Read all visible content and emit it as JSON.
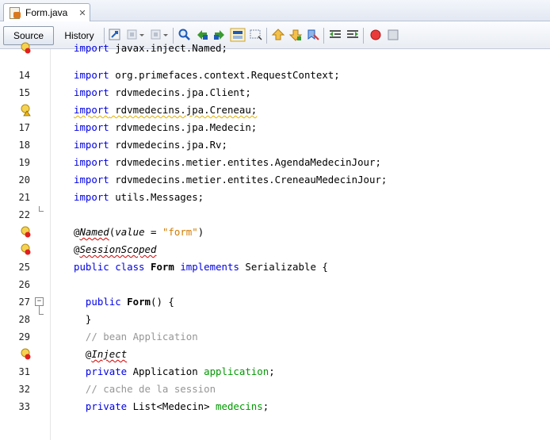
{
  "tab": {
    "filename": "Form.java",
    "close_glyph": "✕"
  },
  "toolbar": {
    "source_label": "Source",
    "history_label": "History"
  },
  "editor": {
    "lines": [
      {
        "num": "",
        "text": "import javax.inject.Named;",
        "clipped": true
      },
      {
        "num": "14",
        "text": "import org.primefaces.context.RequestContext;"
      },
      {
        "num": "15",
        "text": "import rdvmedecins.jpa.Client;"
      },
      {
        "num": "",
        "text": "import rdvmedecins.jpa.Creneau;",
        "hint": "warning"
      },
      {
        "num": "17",
        "text": "import rdvmedecins.jpa.Medecin;"
      },
      {
        "num": "18",
        "text": "import rdvmedecins.jpa.Rv;"
      },
      {
        "num": "19",
        "text": "import rdvmedecins.metier.entites.AgendaMedecinJour;"
      },
      {
        "num": "20",
        "text": "import rdvmedecins.metier.entites.CreneauMedecinJour;"
      },
      {
        "num": "21",
        "text": "import utils.Messages;"
      },
      {
        "num": "22",
        "text": ""
      },
      {
        "num": "",
        "text": "@Named(value = \"form\")",
        "hint": "error"
      },
      {
        "num": "",
        "text": "@SessionScoped",
        "hint": "error"
      },
      {
        "num": "25",
        "text": "public class Form implements Serializable {"
      },
      {
        "num": "26",
        "text": ""
      },
      {
        "num": "27",
        "text": "  public Form() {"
      },
      {
        "num": "28",
        "text": "  }"
      },
      {
        "num": "29",
        "text": "  // bean Application"
      },
      {
        "num": "",
        "text": "  @Inject",
        "hint": "error"
      },
      {
        "num": "31",
        "text": "  private Application application;"
      },
      {
        "num": "32",
        "text": "  // cache de la session"
      },
      {
        "num": "33",
        "text": "  private List<Medecin> medecins;"
      }
    ]
  }
}
